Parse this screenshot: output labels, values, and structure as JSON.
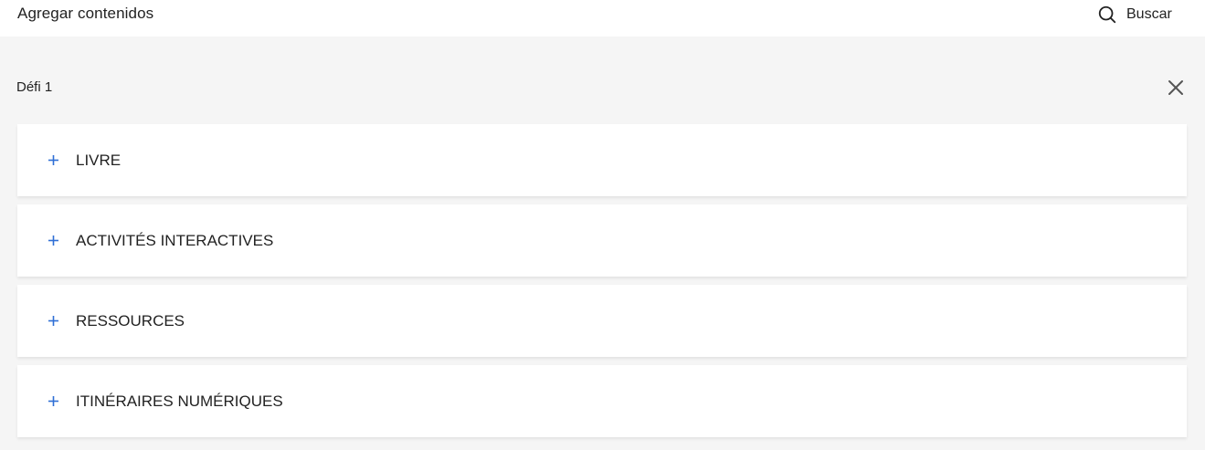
{
  "header": {
    "title": "Agregar contenidos",
    "search_label": "Buscar"
  },
  "section": {
    "title": "Défi 1"
  },
  "accordion": {
    "items": [
      {
        "label": "LIVRE"
      },
      {
        "label": "ACTIVITÉS INTERACTIVES"
      },
      {
        "label": "RESSOURCES"
      },
      {
        "label": "ITINÉRAIRES NUMÉRIQUES"
      }
    ]
  },
  "colors": {
    "accent": "#2f6fd6",
    "text": "#222222",
    "background": "#f5f5f5",
    "card": "#ffffff"
  },
  "icons": {
    "search": "search-icon",
    "close": "close-icon",
    "expand": "plus-icon"
  }
}
